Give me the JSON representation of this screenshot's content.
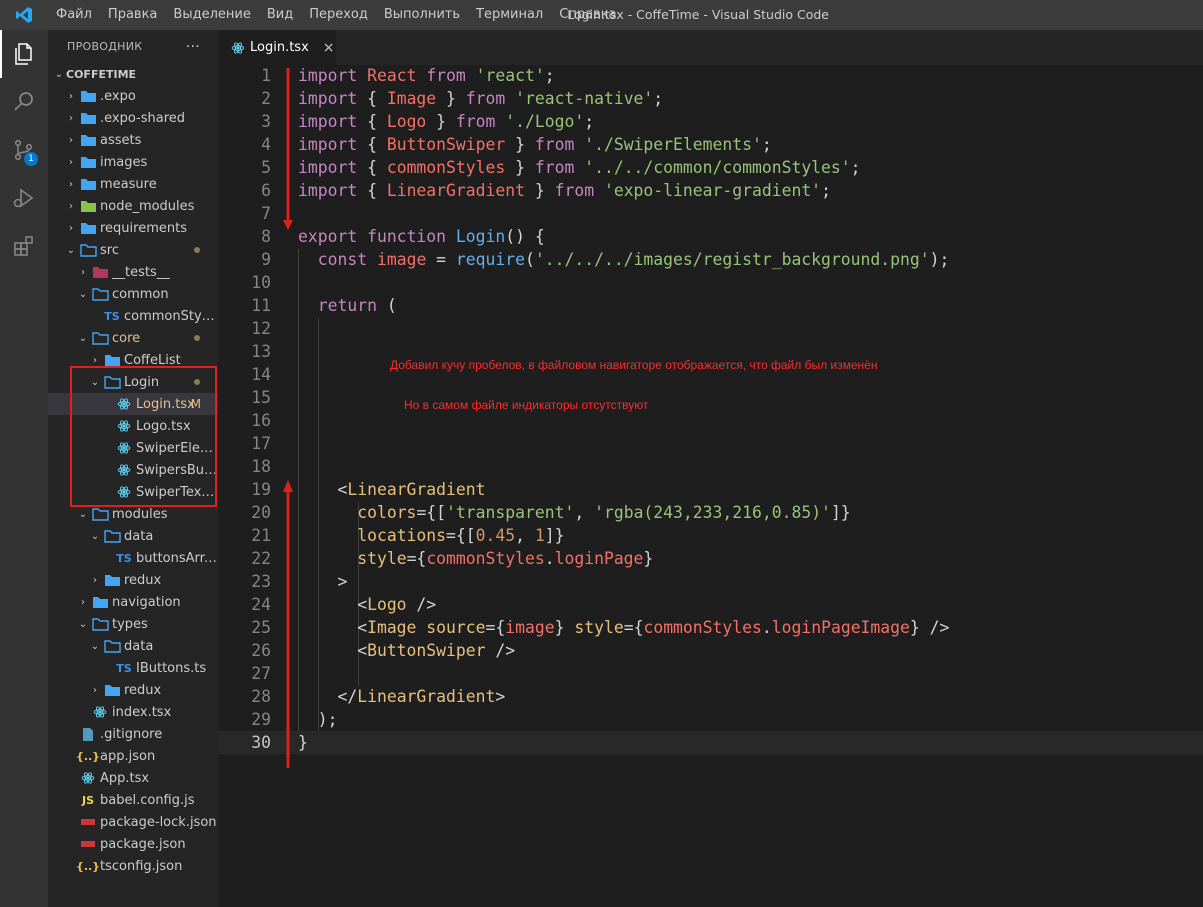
{
  "window": {
    "title": "Login.tsx - CoffeTime - Visual Studio Code"
  },
  "menu": [
    "Файл",
    "Правка",
    "Выделение",
    "Вид",
    "Переход",
    "Выполнить",
    "Терминал",
    "Справка"
  ],
  "activity_bar": [
    {
      "icon": "files-icon",
      "active": true
    },
    {
      "icon": "search-icon"
    },
    {
      "icon": "source-control-icon",
      "badge": "1"
    },
    {
      "icon": "run-debug-icon"
    },
    {
      "icon": "extensions-icon"
    }
  ],
  "sidebar": {
    "header": "ПРОВОДНИК",
    "more": "···",
    "root": "COFFETIME",
    "items": [
      {
        "label": ".expo",
        "type": "folder",
        "depth": 1,
        "state": "collapsed"
      },
      {
        "label": ".expo-shared",
        "type": "folder",
        "depth": 1,
        "state": "collapsed"
      },
      {
        "label": "assets",
        "type": "folder",
        "depth": 1,
        "state": "collapsed"
      },
      {
        "label": "images",
        "type": "folder",
        "depth": 1,
        "state": "collapsed"
      },
      {
        "label": "measure",
        "type": "folder",
        "depth": 1,
        "state": "collapsed"
      },
      {
        "label": "node_modules",
        "type": "folder-node",
        "depth": 1,
        "state": "collapsed"
      },
      {
        "label": "requirements",
        "type": "folder",
        "depth": 1,
        "state": "collapsed"
      },
      {
        "label": "src",
        "type": "folder",
        "depth": 1,
        "state": "expanded",
        "dot": true
      },
      {
        "label": "__tests__",
        "type": "folder-test",
        "depth": 2,
        "state": "collapsed"
      },
      {
        "label": "common",
        "type": "folder",
        "depth": 2,
        "state": "expanded"
      },
      {
        "label": "commonStyles.ts",
        "type": "ts",
        "depth": 3
      },
      {
        "label": "core",
        "type": "folder",
        "depth": 2,
        "state": "expanded",
        "dot": true,
        "modified": true
      },
      {
        "label": "CoffeList",
        "type": "folder",
        "depth": 3,
        "state": "collapsed"
      },
      {
        "label": "Login",
        "type": "folder",
        "depth": 3,
        "state": "expanded",
        "dot": true
      },
      {
        "label": "Login.tsx",
        "type": "react",
        "depth": 4,
        "mark": "M",
        "selected": true
      },
      {
        "label": "Logo.tsx",
        "type": "react",
        "depth": 4
      },
      {
        "label": "SwiperElemen...",
        "type": "react",
        "depth": 4
      },
      {
        "label": "SwipersButto...",
        "type": "react",
        "depth": 4
      },
      {
        "label": "SwiperText.tsx",
        "type": "react",
        "depth": 4
      },
      {
        "label": "modules",
        "type": "folder",
        "depth": 2,
        "state": "expanded"
      },
      {
        "label": "data",
        "type": "folder",
        "depth": 3,
        "state": "expanded"
      },
      {
        "label": "buttonsArr.ts",
        "type": "ts",
        "depth": 4
      },
      {
        "label": "redux",
        "type": "folder",
        "depth": 3,
        "state": "collapsed"
      },
      {
        "label": "navigation",
        "type": "folder",
        "depth": 2,
        "state": "collapsed"
      },
      {
        "label": "types",
        "type": "folder",
        "depth": 2,
        "state": "expanded"
      },
      {
        "label": "data",
        "type": "folder",
        "depth": 3,
        "state": "expanded"
      },
      {
        "label": "IButtons.ts",
        "type": "ts",
        "depth": 4
      },
      {
        "label": "redux",
        "type": "folder",
        "depth": 3,
        "state": "collapsed"
      },
      {
        "label": "index.tsx",
        "type": "react",
        "depth": 2
      },
      {
        "label": ".gitignore",
        "type": "file",
        "depth": 1
      },
      {
        "label": "app.json",
        "type": "json",
        "depth": 1
      },
      {
        "label": "App.tsx",
        "type": "react",
        "depth": 1
      },
      {
        "label": "babel.config.js",
        "type": "js",
        "depth": 1
      },
      {
        "label": "package-lock.json",
        "type": "npm",
        "depth": 1
      },
      {
        "label": "package.json",
        "type": "npm",
        "depth": 1
      },
      {
        "label": "tsconfig.json",
        "type": "json",
        "depth": 1
      }
    ]
  },
  "tab": {
    "label": "Login.tsx",
    "close": "×"
  },
  "editor": {
    "current_line": 30,
    "lines": [
      [
        [
          "k",
          "import"
        ],
        [
          "p",
          " "
        ],
        [
          "v",
          "React"
        ],
        [
          "p",
          " "
        ],
        [
          "k",
          "from"
        ],
        [
          "p",
          " "
        ],
        [
          "s",
          "'react'"
        ],
        [
          "p",
          ";"
        ]
      ],
      [
        [
          "k",
          "import"
        ],
        [
          "p",
          " { "
        ],
        [
          "v",
          "Image"
        ],
        [
          "p",
          " } "
        ],
        [
          "k",
          "from"
        ],
        [
          "p",
          " "
        ],
        [
          "s",
          "'react-native'"
        ],
        [
          "p",
          ";"
        ]
      ],
      [
        [
          "k",
          "import"
        ],
        [
          "p",
          " { "
        ],
        [
          "v",
          "Logo"
        ],
        [
          "p",
          " } "
        ],
        [
          "k",
          "from"
        ],
        [
          "p",
          " "
        ],
        [
          "s",
          "'./Logo'"
        ],
        [
          "p",
          ";"
        ]
      ],
      [
        [
          "k",
          "import"
        ],
        [
          "p",
          " { "
        ],
        [
          "v",
          "ButtonSwiper"
        ],
        [
          "p",
          " } "
        ],
        [
          "k",
          "from"
        ],
        [
          "p",
          " "
        ],
        [
          "s",
          "'./SwiperElements'"
        ],
        [
          "p",
          ";"
        ]
      ],
      [
        [
          "k",
          "import"
        ],
        [
          "p",
          " { "
        ],
        [
          "v",
          "commonStyles"
        ],
        [
          "p",
          " } "
        ],
        [
          "k",
          "from"
        ],
        [
          "p",
          " "
        ],
        [
          "s",
          "'../../common/commonStyles'"
        ],
        [
          "p",
          ";"
        ]
      ],
      [
        [
          "k",
          "import"
        ],
        [
          "p",
          " { "
        ],
        [
          "v",
          "LinearGradient"
        ],
        [
          "p",
          " } "
        ],
        [
          "k",
          "from"
        ],
        [
          "p",
          " "
        ],
        [
          "s",
          "'expo-linear-gradient'"
        ],
        [
          "p",
          ";"
        ]
      ],
      [],
      [
        [
          "k",
          "export"
        ],
        [
          "p",
          " "
        ],
        [
          "k",
          "function"
        ],
        [
          "p",
          " "
        ],
        [
          "f",
          "Login"
        ],
        [
          "p",
          "() {"
        ]
      ],
      [
        [
          "p",
          "  "
        ],
        [
          "k",
          "const"
        ],
        [
          "p",
          " "
        ],
        [
          "v",
          "image"
        ],
        [
          "p",
          " = "
        ],
        [
          "f",
          "require"
        ],
        [
          "p",
          "("
        ],
        [
          "s",
          "'../../../images/registr_background.png'"
        ],
        [
          "p",
          ");"
        ]
      ],
      [],
      [
        [
          "p",
          "  "
        ],
        [
          "k",
          "return"
        ],
        [
          "p",
          " ("
        ]
      ],
      [],
      [],
      [],
      [],
      [],
      [],
      [],
      [
        [
          "p",
          "    <"
        ],
        [
          "t",
          "LinearGradient"
        ]
      ],
      [
        [
          "p",
          "      "
        ],
        [
          "a",
          "colors"
        ],
        [
          "p",
          "={["
        ],
        [
          "s",
          "'transparent'"
        ],
        [
          "p",
          ", "
        ],
        [
          "s",
          "'rgba(243,233,216,0.85)'"
        ],
        [
          "p",
          "]}"
        ]
      ],
      [
        [
          "p",
          "      "
        ],
        [
          "a",
          "locations"
        ],
        [
          "p",
          "={["
        ],
        [
          "n",
          "0.45"
        ],
        [
          "p",
          ", "
        ],
        [
          "n",
          "1"
        ],
        [
          "p",
          "]}"
        ]
      ],
      [
        [
          "p",
          "      "
        ],
        [
          "a",
          "style"
        ],
        [
          "p",
          "={"
        ],
        [
          "v",
          "commonStyles"
        ],
        [
          "p",
          "."
        ],
        [
          "v",
          "loginPage"
        ],
        [
          "p",
          "}"
        ]
      ],
      [
        [
          "p",
          "    >"
        ]
      ],
      [
        [
          "p",
          "      <"
        ],
        [
          "t",
          "Logo"
        ],
        [
          "p",
          " />"
        ]
      ],
      [
        [
          "p",
          "      <"
        ],
        [
          "t",
          "Image"
        ],
        [
          "p",
          " "
        ],
        [
          "a",
          "source"
        ],
        [
          "p",
          "={"
        ],
        [
          "v",
          "image"
        ],
        [
          "p",
          "} "
        ],
        [
          "a",
          "style"
        ],
        [
          "p",
          "={"
        ],
        [
          "v",
          "commonStyles"
        ],
        [
          "p",
          "."
        ],
        [
          "v",
          "loginPageImage"
        ],
        [
          "p",
          "} />"
        ]
      ],
      [
        [
          "p",
          "      <"
        ],
        [
          "t",
          "ButtonSwiper"
        ],
        [
          "p",
          " />"
        ]
      ],
      [],
      [
        [
          "p",
          "    </"
        ],
        [
          "t",
          "LinearGradient"
        ],
        [
          "p",
          ">"
        ]
      ],
      [
        [
          "p",
          "  );"
        ]
      ],
      [
        [
          "p",
          "}"
        ]
      ]
    ]
  },
  "annotations": [
    {
      "text": "Добавил кучу пробелов, в файловом навигаторе отображается, что файл был изменён"
    },
    {
      "text": "Но в самом файле индикаторы отсутствуют"
    }
  ],
  "colors": {
    "annotation": "#ff2a2a",
    "accent": "#007acc"
  }
}
